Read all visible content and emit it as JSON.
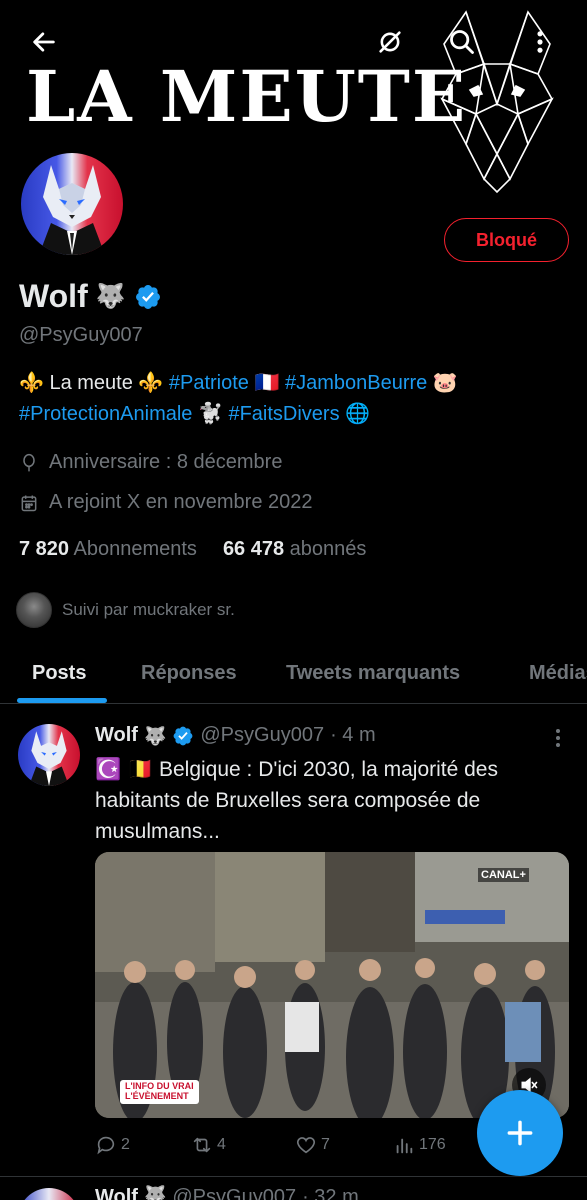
{
  "banner": {
    "title": "LA MEUTE"
  },
  "profile": {
    "display_name": "Wolf",
    "name_emoji": "🐺",
    "handle": "@PsyGuy007",
    "blocked_label": "Bloqué",
    "bio_parts": [
      {
        "text": "⚜️ La meute ⚜️ ",
        "type": "text"
      },
      {
        "text": "#Patriote",
        "type": "tag"
      },
      {
        "text": " 🇫🇷 ",
        "type": "text"
      },
      {
        "text": "#JambonBeurre",
        "type": "tag"
      },
      {
        "text": " 🐷 ",
        "type": "text"
      },
      {
        "text": "#ProtectionAnimale",
        "type": "tag"
      },
      {
        "text": " 🐩 ",
        "type": "text"
      },
      {
        "text": "#FaitsDivers",
        "type": "tag"
      },
      {
        "text": " 🌐",
        "type": "text"
      }
    ],
    "birthday": "Anniversaire : 8 décembre",
    "joined": "A rejoint X en novembre 2022",
    "following_count": "7 820",
    "following_label": "Abonnements",
    "followers_count": "66 478",
    "followers_label": "abonnés",
    "followed_by": "Suivi par muckraker sr."
  },
  "tabs": [
    {
      "label": "Posts",
      "active": true
    },
    {
      "label": "Réponses",
      "active": false
    },
    {
      "label": "Tweets marquants",
      "active": false
    },
    {
      "label": "Médias",
      "active": false
    }
  ],
  "tweet": {
    "name": "Wolf",
    "name_emoji": "🐺",
    "handle": "@PsyGuy007",
    "time": "· 4 m",
    "text": "☪️ 🇧🇪 Belgique : D'ici 2030, la majorité des habitants de Bruxelles sera composée de musulmans...",
    "media_label_line1": "L'INFO DU VRAI",
    "media_label_line2": "L'ÉVÈNEMENT",
    "media_brand": "CANAL+",
    "replies": "2",
    "retweets": "4",
    "likes": "7",
    "views": "176"
  },
  "next_tweet": {
    "name": "Wolf",
    "name_emoji": "🐺",
    "handle": "@PsyGuy007",
    "time": "· 32 m"
  },
  "colors": {
    "accent": "#1d9bf0",
    "blocked": "#f4212e",
    "muted": "#71767b",
    "text": "#e7e9ea"
  }
}
